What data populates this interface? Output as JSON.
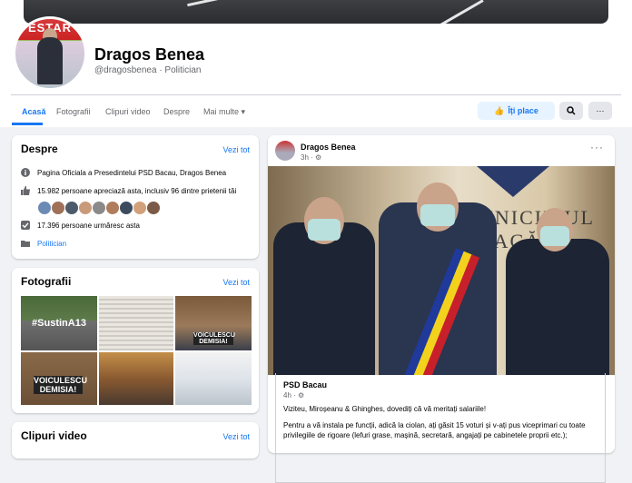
{
  "profile": {
    "name": "Dragos Benea",
    "subtitle": "@dragosbenea · Politician",
    "avatar_banner": "ESTAR"
  },
  "tabs": [
    {
      "label": "Acasă",
      "active": true
    },
    {
      "label": "Fotografii"
    },
    {
      "label": "Clipuri video"
    },
    {
      "label": "Despre"
    },
    {
      "label": "Mai multe ▾"
    }
  ],
  "actions": {
    "like_label": "Îți place",
    "search_icon": "search-icon",
    "more_label": "···"
  },
  "about": {
    "title": "Despre",
    "see_all": "Vezi tot",
    "description": "Pagina Oficiala a Presedintelui PSD Bacau, Dragos Benea",
    "likes": "15.982 persoane apreciază asta, inclusiv 96 dintre prietenii tăi",
    "followers": "17.396 persoane urmăresc asta",
    "category": "Politician"
  },
  "photos": {
    "title": "Fotografii",
    "see_all": "Vezi tot",
    "thumb1_text": "#SustinA13",
    "thumb3_text": "VOICULESCU DEMISIA!",
    "thumb4_text": "VOICULESCU DEMISIA!"
  },
  "videos": {
    "title": "Clipuri video",
    "see_all": "Vezi tot"
  },
  "post": {
    "author": "Dragos Benea",
    "time": "3h · ⚙",
    "more": "···",
    "shared": {
      "author": "PSD Bacau",
      "time": "4h · ⚙",
      "line1": "Viziteu, Miroșeanu & Ghinghes, dovediți că vă meritați salariile!",
      "line2": "Pentru a vă instala pe funcții, adică la ciolan, ați găsit 15 voturi și v-ați pus viceprimari cu toate",
      "line3": "privilegiile de rigoare (lefuri grase, mașină, secretară, angajați pe cabinetele proprii etc.);"
    },
    "photo_text": "UNICIPIUL BACĂU"
  },
  "colors": {
    "accent": "#1877f2",
    "background": "#f0f2f5",
    "secondary_text": "#65676b"
  }
}
